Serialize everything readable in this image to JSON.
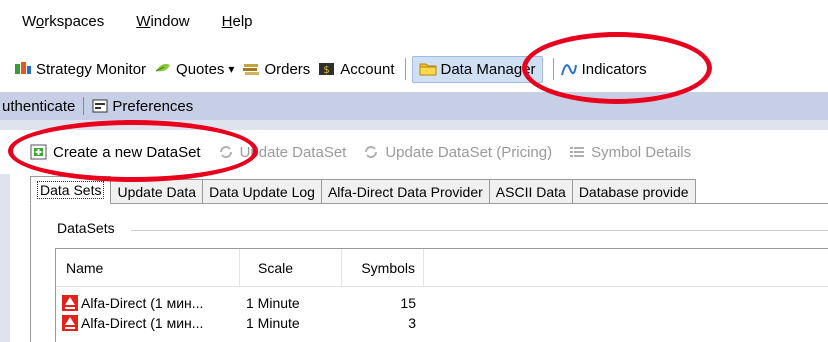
{
  "menubar": {
    "items": [
      {
        "pre": "W",
        "ul": "o",
        "post": "rkspaces"
      },
      {
        "pre": "",
        "ul": "W",
        "post": "indow"
      },
      {
        "pre": "",
        "ul": "H",
        "post": "elp"
      }
    ]
  },
  "toolbar": {
    "strategy_monitor": "Strategy Monitor",
    "quotes": "Quotes",
    "quotes_arrow": "▾",
    "orders": "Orders",
    "accounts": "Account",
    "data_manager": "Data Manager",
    "indicators": "Indicators"
  },
  "bar2": {
    "authenticate": "uthenticate",
    "preferences": "Preferences"
  },
  "actions": {
    "create": "Create a new DataSet",
    "update": "Update DataSet",
    "update_pricing": "Update DataSet (Pricing)",
    "symbol_details": "Symbol Details"
  },
  "tabs": [
    "Data Sets",
    "Update Data",
    "Data Update Log",
    "Alfa-Direct Data Provider",
    "ASCII Data",
    "Database provide"
  ],
  "datasets": {
    "group_label": "DataSets",
    "columns": {
      "name": "Name",
      "scale": "Scale",
      "symbols": "Symbols"
    },
    "rows": [
      {
        "name": "Alfa-Direct (1 мин...",
        "scale": "1 Minute",
        "symbols": "15"
      },
      {
        "name": "Alfa-Direct (1 мин...",
        "scale": "1 Minute",
        "symbols": "3"
      }
    ]
  },
  "colors": {
    "highlight_ellipse": "#e8001c",
    "alfa_logo": "#e2231a",
    "bar_background": "#c7cfe6"
  }
}
